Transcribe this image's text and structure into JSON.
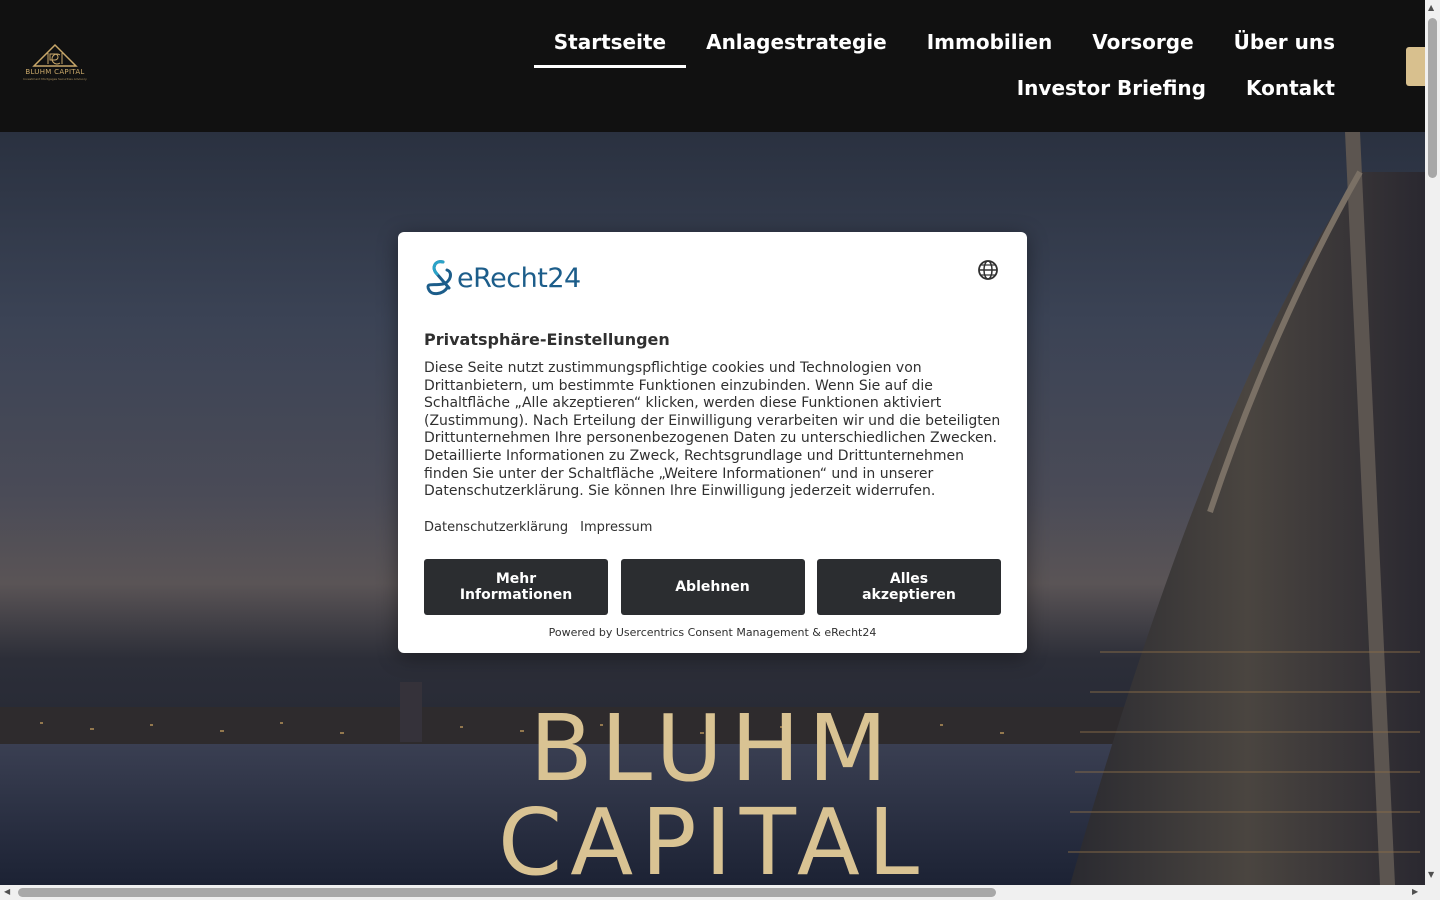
{
  "logo": {
    "name": "BLUHM CAPITAL",
    "tagline": "Investment Mortgages Securities Advisory"
  },
  "nav": {
    "row1": [
      {
        "label": "Startseite",
        "active": true
      },
      {
        "label": "Anlagestrategie",
        "active": false
      },
      {
        "label": "Immobilien",
        "active": false
      },
      {
        "label": "Vorsorge",
        "active": false
      },
      {
        "label": "Über uns",
        "active": false
      }
    ],
    "row2": [
      {
        "label": "Investor Briefing",
        "active": false
      },
      {
        "label": "Kontakt",
        "active": false
      }
    ]
  },
  "hero": {
    "line1": "BLUHM",
    "line2": "CAPITAL"
  },
  "consent": {
    "brand": "eRecht24",
    "title": "Privatsphäre-Einstellungen",
    "body": "Diese Seite nutzt zustimmungspflichtige cookies und Technologien von Drittanbietern, um bestimmte Funktionen einzubinden. Wenn Sie auf die Schaltfläche „Alle akzeptieren“ klicken, werden diese Funktionen aktiviert (Zustimmung). Nach Erteilung der Einwilligung verarbeiten wir und die beteiligten Drittunternehmen Ihre personenbezogenen Daten zu unterschiedlichen Zwecken. Detaillierte Informationen zu Zweck, Rechtsgrundlage und Drittunternehmen finden Sie unter der Schaltfläche „Weitere Informationen“ und in unserer Datenschutzerklärung. Sie können Ihre Einwilligung jederzeit widerrufen.",
    "links": {
      "privacy": "Datenschutzerklärung",
      "imprint": "Impressum"
    },
    "buttons": {
      "more": "Mehr Informationen",
      "decline": "Ablehnen",
      "accept": "Alles akzeptieren"
    },
    "powered": "Powered by Usercentrics Consent Management & eRecht24"
  },
  "colors": {
    "header_bg": "#111111",
    "gold": "#d9c393",
    "button_bg": "#2b2d30",
    "brand_blue": "#1c5d8a"
  },
  "icons": {
    "language": "globe-icon",
    "logo": "triangle-monogram-icon"
  }
}
